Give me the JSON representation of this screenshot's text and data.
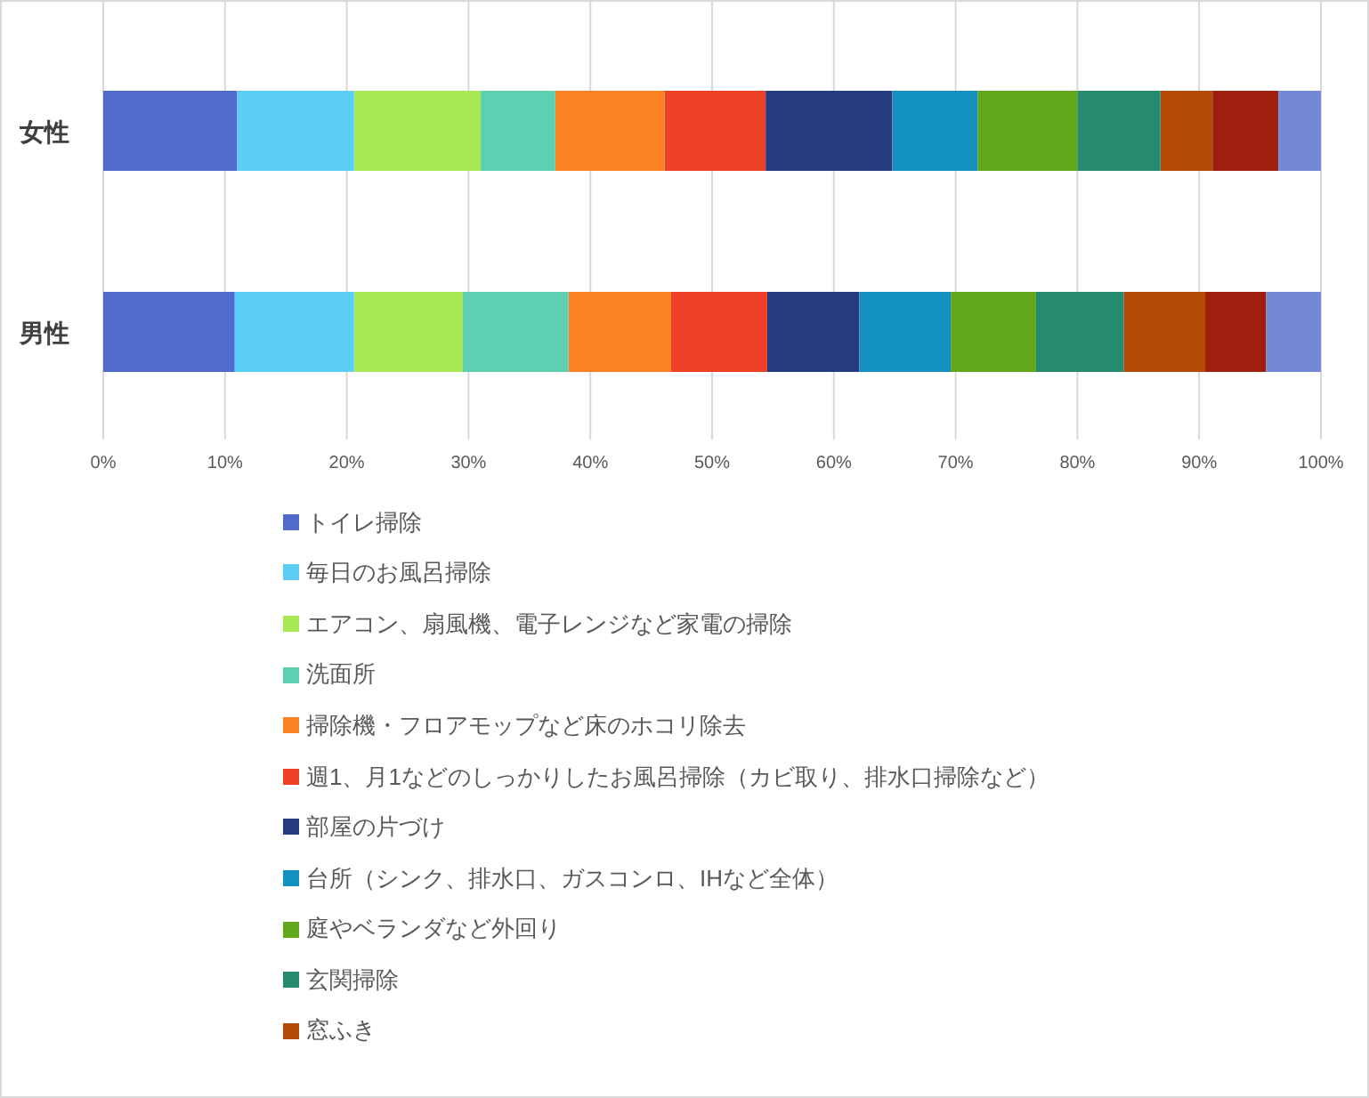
{
  "chart_data": {
    "type": "bar",
    "orientation": "horizontal",
    "stacked": true,
    "categories": [
      "女性",
      "男性"
    ],
    "xlim": [
      0,
      100
    ],
    "grid": true,
    "xticks": [
      {
        "value": 0,
        "label": "0%"
      },
      {
        "value": 10,
        "label": "10%"
      },
      {
        "value": 20,
        "label": "20%"
      },
      {
        "value": 30,
        "label": "30%"
      },
      {
        "value": 40,
        "label": "40%"
      },
      {
        "value": 50,
        "label": "50%"
      },
      {
        "value": 60,
        "label": "60%"
      },
      {
        "value": 70,
        "label": "70%"
      },
      {
        "value": 80,
        "label": "80%"
      },
      {
        "value": 90,
        "label": "90%"
      },
      {
        "value": 100,
        "label": "100%"
      }
    ],
    "series": [
      {
        "name": "トイレ掃除",
        "color": "#4f6ccc",
        "values": [
          11.0,
          10.8
        ]
      },
      {
        "name": "毎日のお風呂掃除",
        "color": "#5bcdf5",
        "values": [
          9.6,
          9.8
        ]
      },
      {
        "name": "エアコン、扇風機、電子レンジなど家電の掃除",
        "color": "#a8e855",
        "values": [
          10.4,
          8.9
        ]
      },
      {
        "name": "洗面所",
        "color": "#5ecfb0",
        "values": [
          6.1,
          8.7
        ]
      },
      {
        "name": "掃除機・フロアモップなど床のホコリ除去",
        "color": "#fb8122",
        "values": [
          9.0,
          8.4
        ]
      },
      {
        "name": "週1、月1などのしっかりしたお風呂掃除（カビ取り、排水口掃除など）",
        "color": "#ee4128",
        "values": [
          8.3,
          7.9
        ]
      },
      {
        "name": "部屋の片づけ",
        "color": "#263a80",
        "values": [
          10.4,
          7.6
        ]
      },
      {
        "name": "台所（シンク、排水口、ガスコンロ、IHなど全体）",
        "color": "#1290c0",
        "values": [
          7.0,
          7.5
        ]
      },
      {
        "name": "庭やベランダなど外回り",
        "color": "#63a71c",
        "values": [
          8.2,
          7.0
        ]
      },
      {
        "name": "玄関掃除",
        "color": "#268a6e",
        "values": [
          6.8,
          7.2
        ]
      },
      {
        "name": "窓ふき",
        "color": "#b24a05",
        "values": [
          4.3,
          6.7
        ]
      },
      {
        "color": "#9e1f0e",
        "values": [
          5.4,
          5.0
        ]
      },
      {
        "color": "#7389d6",
        "values": [
          3.5,
          4.5
        ]
      }
    ]
  }
}
